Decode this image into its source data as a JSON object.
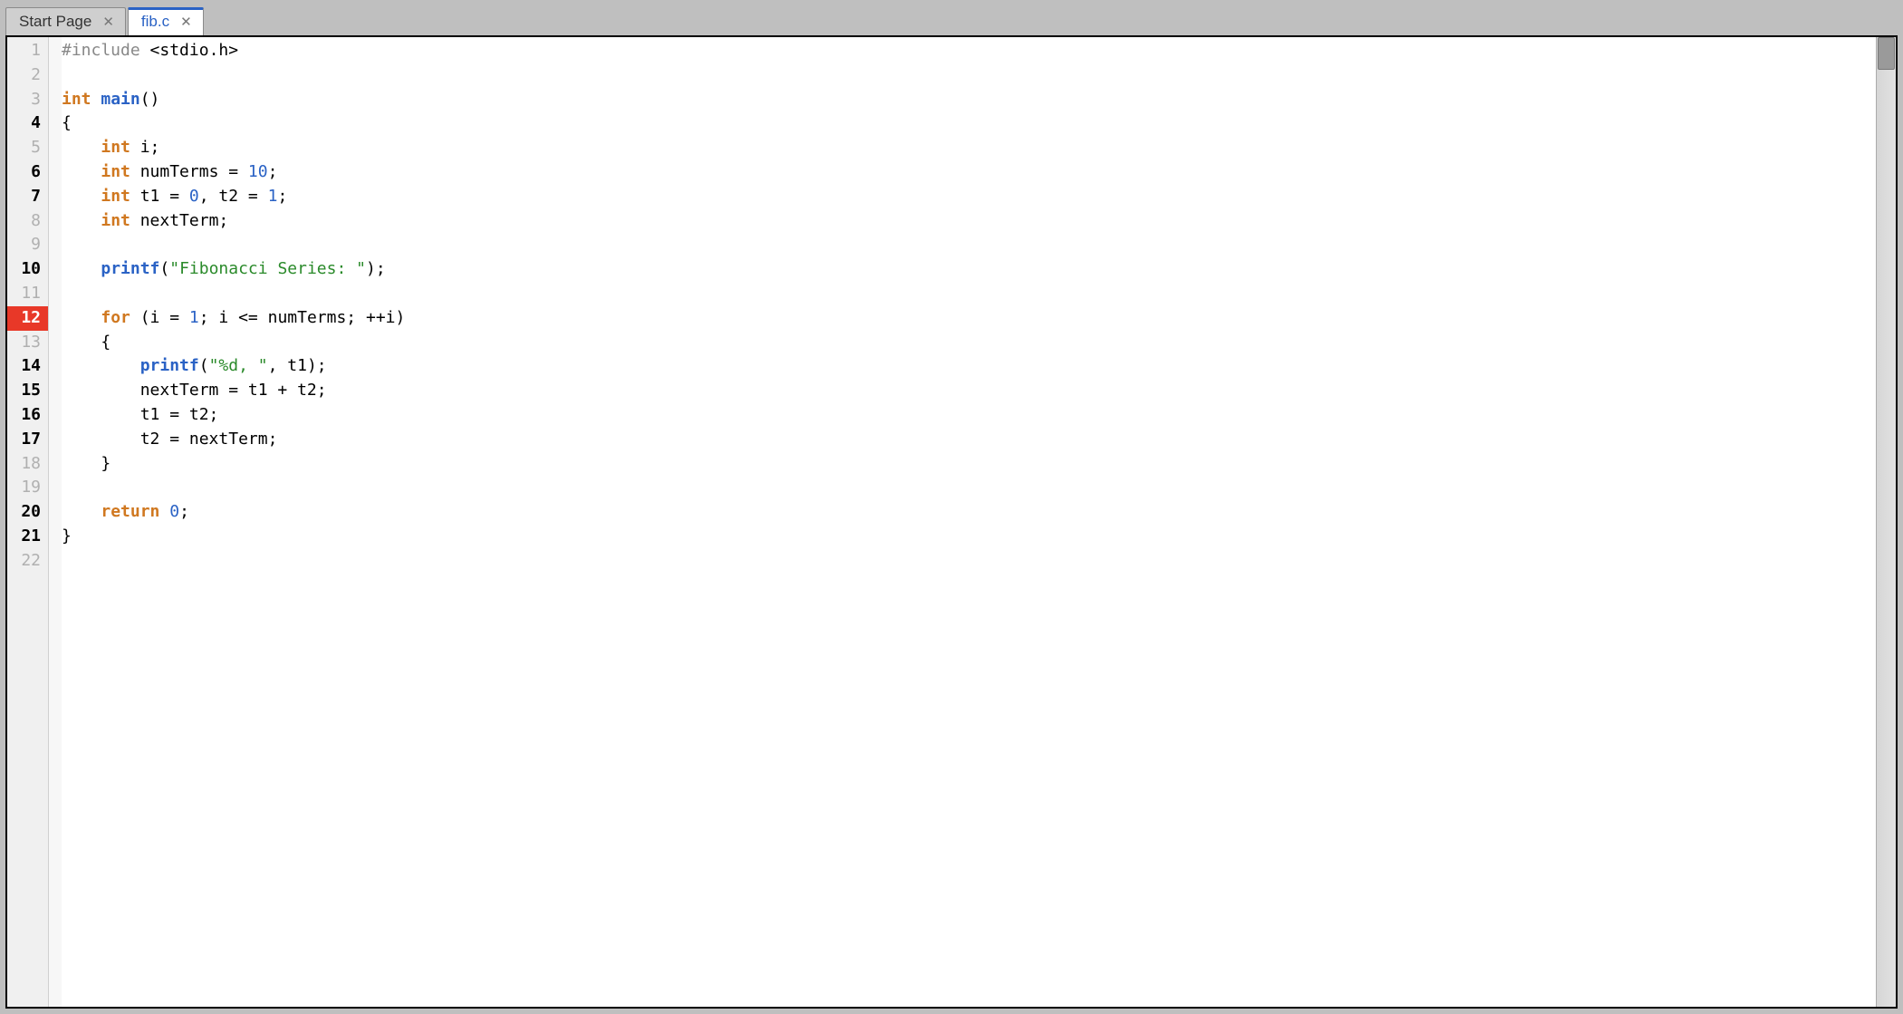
{
  "tabs": [
    {
      "label": "Start Page",
      "active": false
    },
    {
      "label": "fib.c",
      "active": true
    }
  ],
  "gutter": {
    "total_lines": 22,
    "bold_lines": [
      4,
      6,
      7,
      10,
      14,
      15,
      16,
      17,
      20,
      21
    ],
    "breakpoint_lines": [
      12
    ]
  },
  "code": {
    "lines": [
      {
        "n": 1,
        "tokens": [
          {
            "t": "#include ",
            "c": "c-pre"
          },
          {
            "t": "<stdio.h>",
            "c": "c-text"
          }
        ]
      },
      {
        "n": 2,
        "tokens": []
      },
      {
        "n": 3,
        "tokens": [
          {
            "t": "int",
            "c": "c-type"
          },
          {
            "t": " ",
            "c": "c-text"
          },
          {
            "t": "main",
            "c": "c-func"
          },
          {
            "t": "()",
            "c": "c-text"
          }
        ]
      },
      {
        "n": 4,
        "tokens": [
          {
            "t": "{",
            "c": "c-text"
          }
        ]
      },
      {
        "n": 5,
        "tokens": [
          {
            "t": "    ",
            "c": "c-text"
          },
          {
            "t": "int",
            "c": "c-type"
          },
          {
            "t": " i;",
            "c": "c-text"
          }
        ]
      },
      {
        "n": 6,
        "tokens": [
          {
            "t": "    ",
            "c": "c-text"
          },
          {
            "t": "int",
            "c": "c-type"
          },
          {
            "t": " numTerms = ",
            "c": "c-text"
          },
          {
            "t": "10",
            "c": "c-num"
          },
          {
            "t": ";",
            "c": "c-text"
          }
        ]
      },
      {
        "n": 7,
        "tokens": [
          {
            "t": "    ",
            "c": "c-text"
          },
          {
            "t": "int",
            "c": "c-type"
          },
          {
            "t": " t1 = ",
            "c": "c-text"
          },
          {
            "t": "0",
            "c": "c-num"
          },
          {
            "t": ", t2 = ",
            "c": "c-text"
          },
          {
            "t": "1",
            "c": "c-num"
          },
          {
            "t": ";",
            "c": "c-text"
          }
        ]
      },
      {
        "n": 8,
        "tokens": [
          {
            "t": "    ",
            "c": "c-text"
          },
          {
            "t": "int",
            "c": "c-type"
          },
          {
            "t": " nextTerm;",
            "c": "c-text"
          }
        ]
      },
      {
        "n": 9,
        "tokens": []
      },
      {
        "n": 10,
        "tokens": [
          {
            "t": "    ",
            "c": "c-text"
          },
          {
            "t": "printf",
            "c": "c-func"
          },
          {
            "t": "(",
            "c": "c-text"
          },
          {
            "t": "\"Fibonacci Series: \"",
            "c": "c-str"
          },
          {
            "t": ");",
            "c": "c-text"
          }
        ]
      },
      {
        "n": 11,
        "tokens": []
      },
      {
        "n": 12,
        "tokens": [
          {
            "t": "    ",
            "c": "c-text"
          },
          {
            "t": "for",
            "c": "c-kw"
          },
          {
            "t": " (i = ",
            "c": "c-text"
          },
          {
            "t": "1",
            "c": "c-num"
          },
          {
            "t": "; i <= numTerms; ++i)",
            "c": "c-text"
          }
        ]
      },
      {
        "n": 13,
        "tokens": [
          {
            "t": "    {",
            "c": "c-text"
          }
        ]
      },
      {
        "n": 14,
        "tokens": [
          {
            "t": "        ",
            "c": "c-text"
          },
          {
            "t": "printf",
            "c": "c-func"
          },
          {
            "t": "(",
            "c": "c-text"
          },
          {
            "t": "\"%d, \"",
            "c": "c-str"
          },
          {
            "t": ", t1);",
            "c": "c-text"
          }
        ]
      },
      {
        "n": 15,
        "tokens": [
          {
            "t": "        nextTerm = t1 + t2;",
            "c": "c-text"
          }
        ]
      },
      {
        "n": 16,
        "tokens": [
          {
            "t": "        t1 = t2;",
            "c": "c-text"
          }
        ]
      },
      {
        "n": 17,
        "tokens": [
          {
            "t": "        t2 = nextTerm;",
            "c": "c-text"
          }
        ]
      },
      {
        "n": 18,
        "tokens": [
          {
            "t": "    }",
            "c": "c-text"
          }
        ]
      },
      {
        "n": 19,
        "tokens": []
      },
      {
        "n": 20,
        "tokens": [
          {
            "t": "    ",
            "c": "c-text"
          },
          {
            "t": "return",
            "c": "c-kw"
          },
          {
            "t": " ",
            "c": "c-text"
          },
          {
            "t": "0",
            "c": "c-num"
          },
          {
            "t": ";",
            "c": "c-text"
          }
        ]
      },
      {
        "n": 21,
        "tokens": [
          {
            "t": "}",
            "c": "c-text"
          }
        ]
      },
      {
        "n": 22,
        "tokens": []
      }
    ]
  }
}
